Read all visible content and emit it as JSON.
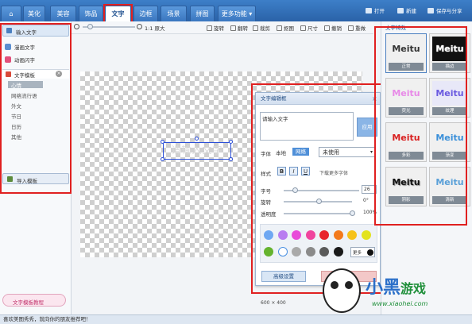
{
  "tabs": [
    "美化",
    "美容",
    "饰品",
    "文字",
    "边框",
    "场景",
    "拼图",
    "更多功能"
  ],
  "top_right": {
    "open": "打开",
    "new": "新建",
    "save": "保存与分享"
  },
  "toolbar": {
    "zoom_label": "1:1 原大",
    "rotate": "旋转",
    "flip": "翻转",
    "crop": "裁剪",
    "cut": "抠图",
    "resize": "尺寸",
    "undo": "撤销",
    "redo": "重做"
  },
  "left_panel": {
    "items": [
      "输入文字",
      "漫画文字",
      "动画闪字"
    ],
    "template_title": "文字模板",
    "sub_items": [
      "心情",
      "网络流行语",
      "外文",
      "节日",
      "日历",
      "其他"
    ],
    "import_button": "导入模板",
    "tutorial_button": "文字模板教程"
  },
  "canvas": {
    "placeholder_text": "请输入文字",
    "size_label": "600 × 400"
  },
  "dialog": {
    "title": "文字编辑框",
    "input_value": "请输入文字",
    "apply_button": "应用",
    "font_label": "字体",
    "font_tabs": [
      "本地",
      "网络"
    ],
    "font_value": "未使用",
    "style_label": "样式",
    "style_buttons": [
      "B",
      "I",
      "U"
    ],
    "download_link": "下载更多字体",
    "size_label": "字号",
    "size_value": "26",
    "rotate_label": "旋转",
    "rotate_value": "0°",
    "opacity_label": "透明度",
    "opacity_value": "100%",
    "more_label": "更多",
    "advanced_button": "高级设置",
    "colors_row1": [
      "#6fa8f2",
      "#b97df0",
      "#e84ad9",
      "#f0449e",
      "#e8232c",
      "#f37a1c",
      "#f6c21a",
      "#e3e31e"
    ],
    "colors_row2": [
      "#65b32e",
      "#ffffff",
      "#a9a9a9",
      "#8a8a8a",
      "#5a5a5a",
      "#1a1a1a"
    ]
  },
  "right_panel": {
    "title": "文字特效",
    "styles": [
      {
        "label": "正常",
        "text": "Meitu",
        "color": "#333333"
      },
      {
        "label": "描边",
        "text": "Meitu",
        "color": "#111111"
      },
      {
        "label": "荧光",
        "text": "Meitu",
        "color": "#e88ae8"
      },
      {
        "label": "纹理",
        "text": "Meitu",
        "color": "#6a5ae0"
      },
      {
        "label": "多彩",
        "text": "Meitu",
        "color": "#d92020"
      },
      {
        "label": "渐变",
        "text": "Meitu",
        "color": "#3a8fd9"
      },
      {
        "label": "阴影",
        "text": "Meitu",
        "color": "#111111"
      },
      {
        "label": "清新",
        "text": "Meitu",
        "color": "#5aa0d8"
      }
    ]
  },
  "status": "喜欢美图秀秀，就向你的朋友推荐吧！",
  "watermark": "小黑游戏 www.xiaohei.com",
  "icons": [
    "search-icon",
    "zoom-in-icon",
    "zoom-out-icon",
    "close-icon",
    "chevron-down-icon",
    "folder-icon",
    "new-icon",
    "save-icon",
    "text-icon",
    "comic-icon",
    "flash-icon",
    "template-icon",
    "import-icon",
    "rotate-icon",
    "flip-icon",
    "crop-icon",
    "cut-icon",
    "resize-icon",
    "undo-icon",
    "redo-icon"
  ]
}
